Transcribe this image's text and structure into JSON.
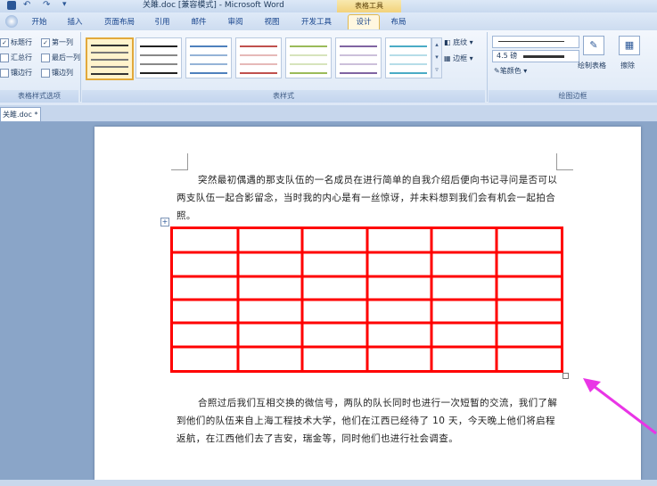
{
  "window": {
    "title": "关雎.doc [兼容模式] - Microsoft Word",
    "context_tab_group": "表格工具"
  },
  "tabs": [
    {
      "label": "开始",
      "active": false
    },
    {
      "label": "插入",
      "active": false
    },
    {
      "label": "页面布局",
      "active": false
    },
    {
      "label": "引用",
      "active": false
    },
    {
      "label": "邮件",
      "active": false
    },
    {
      "label": "审阅",
      "active": false
    },
    {
      "label": "视图",
      "active": false
    },
    {
      "label": "开发工具",
      "active": false
    },
    {
      "label": "设计",
      "active": true
    },
    {
      "label": "布局",
      "active": false
    }
  ],
  "ribbon": {
    "table_style_options": {
      "items": [
        {
          "label": "标题行",
          "checked": true
        },
        {
          "label": "第一列",
          "checked": true
        },
        {
          "label": "汇总行",
          "checked": false
        },
        {
          "label": "最后一列",
          "checked": false
        },
        {
          "label": "镶边行",
          "checked": false
        },
        {
          "label": "镶边列",
          "checked": false
        }
      ],
      "group_label": "表格样式选项"
    },
    "table_styles": {
      "group_label": "表样式",
      "shading_label": "底纹",
      "borders_label": "边框"
    },
    "draw_borders": {
      "line_weight": "4.5 磅",
      "pen_color_label": "笔颜色",
      "draw_table_label": "绘制表格",
      "eraser_label": "擦除",
      "group_label": "绘图边框"
    }
  },
  "document": {
    "tab_label": "关雎.doc *",
    "para1": "突然最初偶遇的那支队伍的一名成员在进行简单的自我介绍后便向书记寻问是否可以两支队伍一起合影留念，当时我的内心是有一丝惊讶，并未料想到我们会有机会一起拍合照。",
    "para2": "合照过后我们互相交换的微信号，两队的队长同时也进行一次短暂的交流，我们了解到他们的队伍来自上海工程技术大学，他们在江西已经待了 10 天，今天晚上他们将启程返航，在江西他们去了吉安，瑞金等，同时他们也进行社会调查。",
    "table": {
      "rows": 6,
      "cols": 6,
      "border_color": "#ff0000"
    }
  },
  "colors": {
    "accent": "#ff0000",
    "arrow": "#e935e6"
  }
}
